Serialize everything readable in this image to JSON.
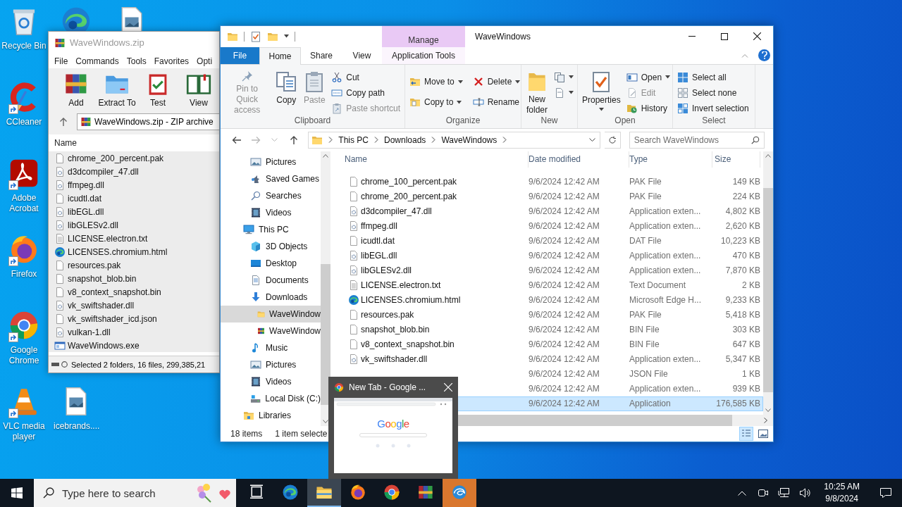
{
  "desktop": {
    "icons": [
      {
        "kind": "recycle-bin",
        "label": "Recycle Bin",
        "shortcut": false
      },
      {
        "kind": "edge",
        "shortcut": false
      },
      {
        "kind": "image-file",
        "shortcut": false
      },
      {
        "kind": "ccleaner",
        "label": "CCleaner",
        "shortcut": true
      },
      {
        "kind": "acrobat",
        "label": "Adobe Acrobat",
        "shortcut": true
      },
      {
        "kind": "firefox",
        "label": "Firefox",
        "shortcut": true
      },
      {
        "kind": "chrome",
        "label": "Google Chrome",
        "shortcut": true
      },
      {
        "kind": "vlc",
        "label": "VLC media player",
        "shortcut": true
      },
      {
        "kind": "image-file",
        "label": "icebrands....",
        "shortcut": false
      }
    ]
  },
  "archive_window": {
    "title": "WaveWindows.zip",
    "menu": [
      "File",
      "Commands",
      "Tools",
      "Favorites",
      "Opti"
    ],
    "tools": [
      {
        "kind": "add",
        "label": "Add"
      },
      {
        "kind": "extract",
        "label": "Extract To"
      },
      {
        "kind": "test",
        "label": "Test"
      },
      {
        "kind": "view",
        "label": "View"
      }
    ],
    "path": "WaveWindows.zip - ZIP archive",
    "column": "Name",
    "files": [
      {
        "kind": "file",
        "name": "chrome_200_percent.pak",
        "selected": true
      },
      {
        "kind": "dll",
        "name": "d3dcompiler_47.dll",
        "selected": true
      },
      {
        "kind": "dll",
        "name": "ffmpeg.dll",
        "selected": true
      },
      {
        "kind": "file",
        "name": "icudtl.dat",
        "selected": true
      },
      {
        "kind": "dll",
        "name": "libEGL.dll",
        "selected": true
      },
      {
        "kind": "dll",
        "name": "libGLESv2.dll",
        "selected": true
      },
      {
        "kind": "text",
        "name": "LICENSE.electron.txt",
        "selected": true
      },
      {
        "kind": "edge",
        "name": "LICENSES.chromium.html",
        "selected": true
      },
      {
        "kind": "file",
        "name": "resources.pak",
        "selected": true
      },
      {
        "kind": "file",
        "name": "snapshot_blob.bin",
        "selected": true
      },
      {
        "kind": "file",
        "name": "v8_context_snapshot.bin",
        "selected": true
      },
      {
        "kind": "dll",
        "name": "vk_swiftshader.dll",
        "selected": true
      },
      {
        "kind": "file",
        "name": "vk_swiftshader_icd.json",
        "selected": true
      },
      {
        "kind": "dll",
        "name": "vulkan-1.dll",
        "selected": true
      },
      {
        "kind": "exe",
        "name": "WaveWindows.exe",
        "selected": true
      }
    ],
    "status": "Selected 2 folders, 16 files, 299,385,21"
  },
  "explorer": {
    "title": "WaveWindows",
    "context_header": "Manage",
    "tabs": [
      {
        "kind": "file",
        "label": "File",
        "selected": false
      },
      {
        "kind": "normal",
        "label": "Home",
        "selected": true
      },
      {
        "kind": "normal",
        "label": "Share",
        "selected": false
      },
      {
        "kind": "normal",
        "label": "View",
        "selected": false
      },
      {
        "kind": "contextual",
        "label": "Application Tools",
        "selected": false
      }
    ],
    "ribbon": [
      {
        "name": "Clipboard",
        "large": [
          {
            "kind": "pin",
            "label": "Pin to Quick access",
            "disabled": true,
            "menu": false
          },
          {
            "kind": "copy",
            "label": "Copy",
            "disabled": false,
            "menu": false
          },
          {
            "kind": "paste",
            "label": "Paste",
            "disabled": true,
            "menu": false
          }
        ],
        "small": [
          {
            "kind": "cut",
            "label": "Cut",
            "disabled": false,
            "menu": false
          },
          {
            "kind": "copy-path",
            "label": "Copy path",
            "disabled": false,
            "menu": false
          },
          {
            "kind": "paste-shortcut",
            "label": "Paste shortcut",
            "disabled": true,
            "menu": false
          }
        ]
      },
      {
        "name": "Organize",
        "small": [
          {
            "kind": "move-to",
            "label": "Move to",
            "disabled": false,
            "menu": true
          },
          {
            "kind": "copy-to",
            "label": "Copy to",
            "disabled": false,
            "menu": true
          },
          {
            "kind": "delete",
            "label": "Delete",
            "disabled": false,
            "menu": true
          },
          {
            "kind": "rename",
            "label": "Rename",
            "disabled": false,
            "menu": false
          }
        ]
      },
      {
        "name": "New",
        "large": [
          {
            "kind": "new-folder",
            "label": "New folder",
            "disabled": false,
            "menu": false
          }
        ],
        "small": [
          {
            "kind": "new-item",
            "menu": true
          },
          {
            "kind": "easy-access",
            "menu": true
          }
        ]
      },
      {
        "name": "Open",
        "large": [
          {
            "kind": "properties",
            "label": "Properties",
            "disabled": false,
            "menu": true
          }
        ],
        "small": [
          {
            "kind": "open",
            "label": "Open",
            "disabled": false,
            "menu": true
          },
          {
            "kind": "edit",
            "label": "Edit",
            "disabled": true,
            "menu": false
          },
          {
            "kind": "history",
            "label": "History",
            "disabled": false,
            "menu": false
          }
        ]
      },
      {
        "name": "Select",
        "small": [
          {
            "kind": "select-all",
            "label": "Select all",
            "disabled": false,
            "menu": false
          },
          {
            "kind": "select-none",
            "label": "Select none",
            "disabled": false,
            "menu": false
          },
          {
            "kind": "invert",
            "label": "Invert selection",
            "disabled": false,
            "menu": false
          }
        ]
      }
    ],
    "nav_buttons": [
      {
        "kind": "back",
        "disabled": false
      },
      {
        "kind": "forward",
        "disabled": true
      },
      {
        "kind": "recent",
        "disabled": true
      },
      {
        "kind": "up",
        "disabled": false
      }
    ],
    "crumbs": [
      "This PC",
      "Downloads",
      "WaveWindows"
    ],
    "search": {
      "placeholder": "Search WaveWindows"
    },
    "nav": {
      "items": [
        {
          "children": [
            {
              "kind": "pictures",
              "label": "Pictures",
              "selected": false
            },
            {
              "kind": "games",
              "label": "Saved Games",
              "selected": false
            },
            {
              "kind": "searches",
              "label": "Searches",
              "selected": false
            },
            {
              "kind": "videos",
              "label": "Videos",
              "selected": false
            }
          ]
        },
        {
          "kind": "pc",
          "label": "This PC",
          "selected": false,
          "children": [
            {
              "kind": "cube",
              "label": "3D Objects",
              "selected": false
            },
            {
              "kind": "desktop",
              "label": "Desktop",
              "selected": false
            },
            {
              "kind": "documents",
              "label": "Documents",
              "selected": false
            },
            {
              "kind": "downloads",
              "label": "Downloads",
              "selected": false,
              "children": [
                {
                  "kind": "folder",
                  "label": "WaveWindow",
                  "selected": true
                },
                {
                  "kind": "winrar",
                  "label": "WaveWindow",
                  "selected": false
                }
              ]
            },
            {
              "kind": "music",
              "label": "Music",
              "selected": false
            },
            {
              "kind": "pictures",
              "label": "Pictures",
              "selected": false
            },
            {
              "kind": "videos",
              "label": "Videos",
              "selected": false
            },
            {
              "kind": "disk",
              "label": "Local Disk (C:)",
              "selected": false
            }
          ]
        },
        {
          "kind": "libraries",
          "label": "Libraries",
          "selected": false
        }
      ]
    },
    "columns": [
      "Name",
      "Date modified",
      "Type",
      "Size"
    ],
    "files": [
      {
        "kind": "file",
        "name": "chrome_100_percent.pak",
        "date": "9/6/2024 12:42 AM",
        "type": "PAK File",
        "size": "149 KB",
        "selected": false
      },
      {
        "kind": "file",
        "name": "chrome_200_percent.pak",
        "date": "9/6/2024 12:42 AM",
        "type": "PAK File",
        "size": "224 KB",
        "selected": false
      },
      {
        "kind": "dll",
        "name": "d3dcompiler_47.dll",
        "date": "9/6/2024 12:42 AM",
        "type": "Application exten...",
        "size": "4,802 KB",
        "selected": false
      },
      {
        "kind": "dll",
        "name": "ffmpeg.dll",
        "date": "9/6/2024 12:42 AM",
        "type": "Application exten...",
        "size": "2,620 KB",
        "selected": false
      },
      {
        "kind": "file",
        "name": "icudtl.dat",
        "date": "9/6/2024 12:42 AM",
        "type": "DAT File",
        "size": "10,223 KB",
        "selected": false
      },
      {
        "kind": "dll",
        "name": "libEGL.dll",
        "date": "9/6/2024 12:42 AM",
        "type": "Application exten...",
        "size": "470 KB",
        "selected": false
      },
      {
        "kind": "dll",
        "name": "libGLESv2.dll",
        "date": "9/6/2024 12:42 AM",
        "type": "Application exten...",
        "size": "7,870 KB",
        "selected": false
      },
      {
        "kind": "text",
        "name": "LICENSE.electron.txt",
        "date": "9/6/2024 12:42 AM",
        "type": "Text Document",
        "size": "2 KB",
        "selected": false
      },
      {
        "kind": "edge",
        "name": "LICENSES.chromium.html",
        "date": "9/6/2024 12:42 AM",
        "type": "Microsoft Edge H...",
        "size": "9,233 KB",
        "selected": false
      },
      {
        "kind": "file",
        "name": "resources.pak",
        "date": "9/6/2024 12:42 AM",
        "type": "PAK File",
        "size": "5,418 KB",
        "selected": false
      },
      {
        "kind": "file",
        "name": "snapshot_blob.bin",
        "date": "9/6/2024 12:42 AM",
        "type": "BIN File",
        "size": "303 KB",
        "selected": false
      },
      {
        "kind": "file",
        "name": "v8_context_snapshot.bin",
        "date": "9/6/2024 12:42 AM",
        "type": "BIN File",
        "size": "647 KB",
        "selected": false
      },
      {
        "kind": "dll",
        "name": "vk_swiftshader.dll",
        "date": "9/6/2024 12:42 AM",
        "type": "Application exten...",
        "size": "5,347 KB",
        "selected": false
      },
      {
        "date": "9/6/2024 12:42 AM",
        "type": "JSON File",
        "size": "1 KB",
        "selected": false
      },
      {
        "date": "9/6/2024 12:42 AM",
        "type": "Application exten...",
        "size": "939 KB",
        "selected": false
      },
      {
        "date": "9/6/2024 12:42 AM",
        "type": "Application",
        "size": "176,585 KB",
        "selected": true
      }
    ],
    "status": {
      "count": "18 items",
      "selection": "1 item selecte"
    },
    "views": [
      {
        "kind": "details",
        "selected": true
      },
      {
        "kind": "tiles",
        "selected": false
      }
    ]
  },
  "thumbnail": {
    "title": "New Tab - Google ...",
    "logo": "Google"
  },
  "taskbar": {
    "search": {
      "placeholder": "Type here to search"
    },
    "apps": [
      {
        "kind": "task-view",
        "active": false,
        "flashing": false
      },
      {
        "kind": "edge",
        "active": false,
        "flashing": false
      },
      {
        "kind": "explorer",
        "active": true,
        "flashing": false
      },
      {
        "kind": "firefox",
        "active": false,
        "flashing": false
      },
      {
        "kind": "chrome",
        "active": false,
        "flashing": false
      },
      {
        "kind": "winrar",
        "active": false,
        "flashing": false
      },
      {
        "kind": "app",
        "active": false,
        "flashing": true
      }
    ],
    "time": "10:25 AM",
    "date": "9/8/2024"
  }
}
